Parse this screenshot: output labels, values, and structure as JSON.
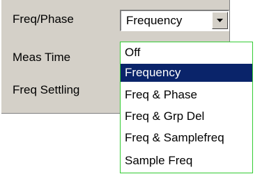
{
  "panel": {
    "rows": [
      {
        "label": "Freq/Phase"
      },
      {
        "label": "Meas Time"
      },
      {
        "label": "Freq Settling"
      }
    ]
  },
  "combo": {
    "value": "Frequency"
  },
  "dropdown": {
    "options": [
      "Off",
      "Frequency",
      "Freq & Phase",
      "Freq & Grp Del",
      "Freq & Samplefreq",
      "Sample Freq"
    ],
    "selected": "Frequency"
  },
  "colors": {
    "panel_bg": "#d4d0c8",
    "selection_bg": "#0a246a",
    "dropdown_border": "#33cc33"
  },
  "icons": {
    "combo_button": "chevron-down-icon"
  }
}
